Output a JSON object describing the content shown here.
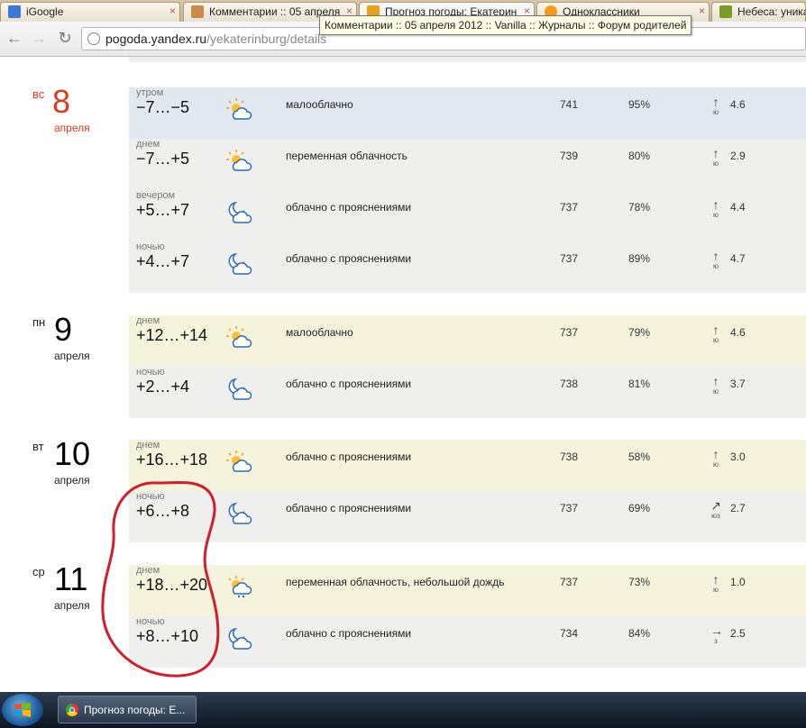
{
  "browser": {
    "tabs": [
      {
        "title": "iGoogle",
        "close": "×",
        "favicon_color": "#3c78d8"
      },
      {
        "title": "Комментарии :: 05 апреля",
        "close": "×",
        "favicon_color": "#c98a4b"
      },
      {
        "title": "Прогноз погоды: Екатерин",
        "close": "×",
        "favicon_color": "#e8a317"
      },
      {
        "title": "Одноклассники",
        "close": "×",
        "favicon_color": "#f59a1a"
      },
      {
        "title": "Небеса: уника",
        "close": "",
        "favicon_color": "#7a9a2a"
      }
    ],
    "url_host": "pogoda.yandex.ru",
    "url_path": "/yekaterinburg/details",
    "tooltip": "Комментарии :: 05 апреля 2012 :: Vanilla :: Журналы :: Форум родителей"
  },
  "days": [
    {
      "dow": "вс",
      "num": "8",
      "month": "апреля",
      "weekend": true,
      "rows": [
        {
          "period": "утром",
          "temp": "−7…−5",
          "icon": "partly-cloudy-day-icon",
          "cond": "малооблачно",
          "pressure": "741",
          "humidity": "95%",
          "wind_arrow": "↑",
          "wind_dir": "ю",
          "wind": "4.6",
          "bg": "#e2e8ef"
        },
        {
          "period": "днем",
          "temp": "−7…+5",
          "icon": "partly-cloudy-day-icon",
          "cond": "переменная облачность",
          "pressure": "739",
          "humidity": "80%",
          "wind_arrow": "↑",
          "wind_dir": "ю",
          "wind": "2.9",
          "bg": "#efefed"
        },
        {
          "period": "вечером",
          "temp": "+5…+7",
          "icon": "cloudy-night-icon",
          "cond": "облачно с прояснениями",
          "pressure": "737",
          "humidity": "78%",
          "wind_arrow": "↑",
          "wind_dir": "ю",
          "wind": "4.4",
          "bg": "#efefed"
        },
        {
          "period": "ночью",
          "temp": "+4…+7",
          "icon": "cloudy-night-icon",
          "cond": "облачно с прояснениями",
          "pressure": "737",
          "humidity": "89%",
          "wind_arrow": "↑",
          "wind_dir": "ю",
          "wind": "4.7",
          "bg": "#efefed"
        }
      ]
    },
    {
      "dow": "пн",
      "num": "9",
      "month": "апреля",
      "weekend": false,
      "rows": [
        {
          "period": "днем",
          "temp": "+12…+14",
          "icon": "partly-cloudy-day-icon",
          "cond": "малооблачно",
          "pressure": "737",
          "humidity": "79%",
          "wind_arrow": "↑",
          "wind_dir": "ю",
          "wind": "4.6",
          "bg": "#f6f3dd"
        },
        {
          "period": "ночью",
          "temp": "+2…+4",
          "icon": "cloudy-night-icon",
          "cond": "облачно с прояснениями",
          "pressure": "738",
          "humidity": "81%",
          "wind_arrow": "↑",
          "wind_dir": "ю",
          "wind": "3.7",
          "bg": "#efefed"
        }
      ]
    },
    {
      "dow": "вт",
      "num": "10",
      "month": "апреля",
      "weekend": false,
      "rows": [
        {
          "period": "днем",
          "temp": "+16…+18",
          "icon": "partly-cloudy-day-icon",
          "cond": "облачно с прояснениями",
          "pressure": "738",
          "humidity": "58%",
          "wind_arrow": "↑",
          "wind_dir": "ю",
          "wind": "3.0",
          "bg": "#f6f3dd"
        },
        {
          "period": "ночью",
          "temp": "+6…+8",
          "icon": "cloudy-night-icon",
          "cond": "облачно с прояснениями",
          "pressure": "737",
          "humidity": "69%",
          "wind_arrow": "↗",
          "wind_dir": "юз",
          "wind": "2.7",
          "bg": "#efefed"
        }
      ]
    },
    {
      "dow": "ср",
      "num": "11",
      "month": "апреля",
      "weekend": false,
      "rows": [
        {
          "period": "днем",
          "temp": "+18…+20",
          "icon": "light-rain-day-icon",
          "cond": "переменная облачность, небольшой дождь",
          "pressure": "737",
          "humidity": "73%",
          "wind_arrow": "↑",
          "wind_dir": "ю",
          "wind": "1.0",
          "bg": "#f6f3dd"
        },
        {
          "period": "ночью",
          "temp": "+8…+10",
          "icon": "cloudy-night-icon",
          "cond": "облачно с прояснениями",
          "pressure": "734",
          "humidity": "84%",
          "wind_arrow": "→",
          "wind_dir": "з",
          "wind": "2.5",
          "bg": "#efefed"
        }
      ]
    }
  ],
  "taskbar": {
    "task_title": "Прогноз погоды: Е..."
  }
}
